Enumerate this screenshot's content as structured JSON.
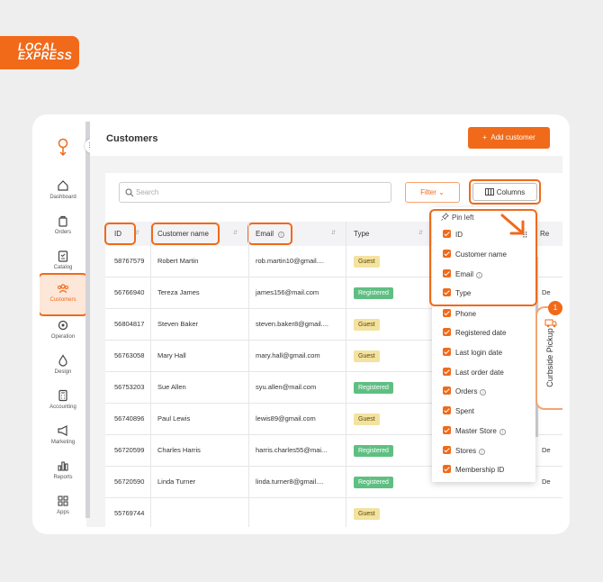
{
  "brand": {
    "logo_line1": "LOCAL",
    "logo_line2": "EXPRESS",
    "accent": "#f06a1a"
  },
  "sidebar": {
    "items": [
      {
        "label": "Dashboard",
        "icon": "home-icon"
      },
      {
        "label": "Orders",
        "icon": "bag-icon"
      },
      {
        "label": "Catalog",
        "icon": "catalog-icon"
      },
      {
        "label": "Customers",
        "icon": "users-icon",
        "active": true
      },
      {
        "label": "Operation",
        "icon": "operation-icon"
      },
      {
        "label": "Design",
        "icon": "drop-icon"
      },
      {
        "label": "Accounting",
        "icon": "calculator-icon"
      },
      {
        "label": "Marketing",
        "icon": "megaphone-icon"
      },
      {
        "label": "Reports",
        "icon": "bar-chart-icon"
      },
      {
        "label": "Apps",
        "icon": "grid-icon"
      }
    ]
  },
  "header": {
    "title": "Customers",
    "add_button": "Add customer",
    "add_icon": "+"
  },
  "toolbar": {
    "search_placeholder": "Search",
    "filter_label": "Filter",
    "columns_label": "Columns"
  },
  "table": {
    "columns": [
      "ID",
      "Customer name",
      "Email",
      "Type",
      "Re"
    ],
    "rows": [
      {
        "id": "58767579",
        "name": "Robert Martin",
        "email": "rob.martin10@gmail....",
        "type": "Guest",
        "extra": ""
      },
      {
        "id": "56766940",
        "name": "Tereza James",
        "email": "james156@mail.com",
        "type": "Registered",
        "extra": "De"
      },
      {
        "id": "56804817",
        "name": "Steven Baker",
        "email": "steven.baker8@gmail....",
        "type": "Guest",
        "extra": ""
      },
      {
        "id": "56763058",
        "name": "Mary Hall",
        "email": "mary.hall@gmail.com",
        "type": "Guest",
        "extra": ""
      },
      {
        "id": "56753203",
        "name": "Sue Allen",
        "email": "syu.allen@mail.com",
        "type": "Registered",
        "extra": "De"
      },
      {
        "id": "56740896",
        "name": "Paul Lewis",
        "email": "lewis89@gmail.com",
        "type": "Guest",
        "extra": ""
      },
      {
        "id": "56720599",
        "name": "Charles Harris",
        "email": "harris.charles55@mai...",
        "type": "Registered",
        "extra": "De"
      },
      {
        "id": "56720590",
        "name": "Linda Turner",
        "email": "linda.turner8@gmail....",
        "type": "Registered",
        "extra": "De"
      },
      {
        "id": "55769744",
        "name": "",
        "email": "",
        "type": "Guest",
        "extra": ""
      }
    ]
  },
  "columns_menu": {
    "pin_label": "Pin left",
    "items": [
      {
        "label": "ID",
        "info": false
      },
      {
        "label": "Customer name",
        "info": false
      },
      {
        "label": "Email",
        "info": true
      },
      {
        "label": "Type",
        "info": false
      },
      {
        "label": "Phone",
        "info": false
      },
      {
        "label": "Registered date",
        "info": false
      },
      {
        "label": "Last login date",
        "info": false
      },
      {
        "label": "Last order date",
        "info": false
      },
      {
        "label": "Orders",
        "info": true
      },
      {
        "label": "Spent",
        "info": false
      },
      {
        "label": "Master Store",
        "info": true
      },
      {
        "label": "Stores",
        "info": true
      },
      {
        "label": "Membership ID",
        "info": false
      }
    ]
  },
  "curbside": {
    "label": "Curbside Pickup",
    "badge": "1"
  }
}
